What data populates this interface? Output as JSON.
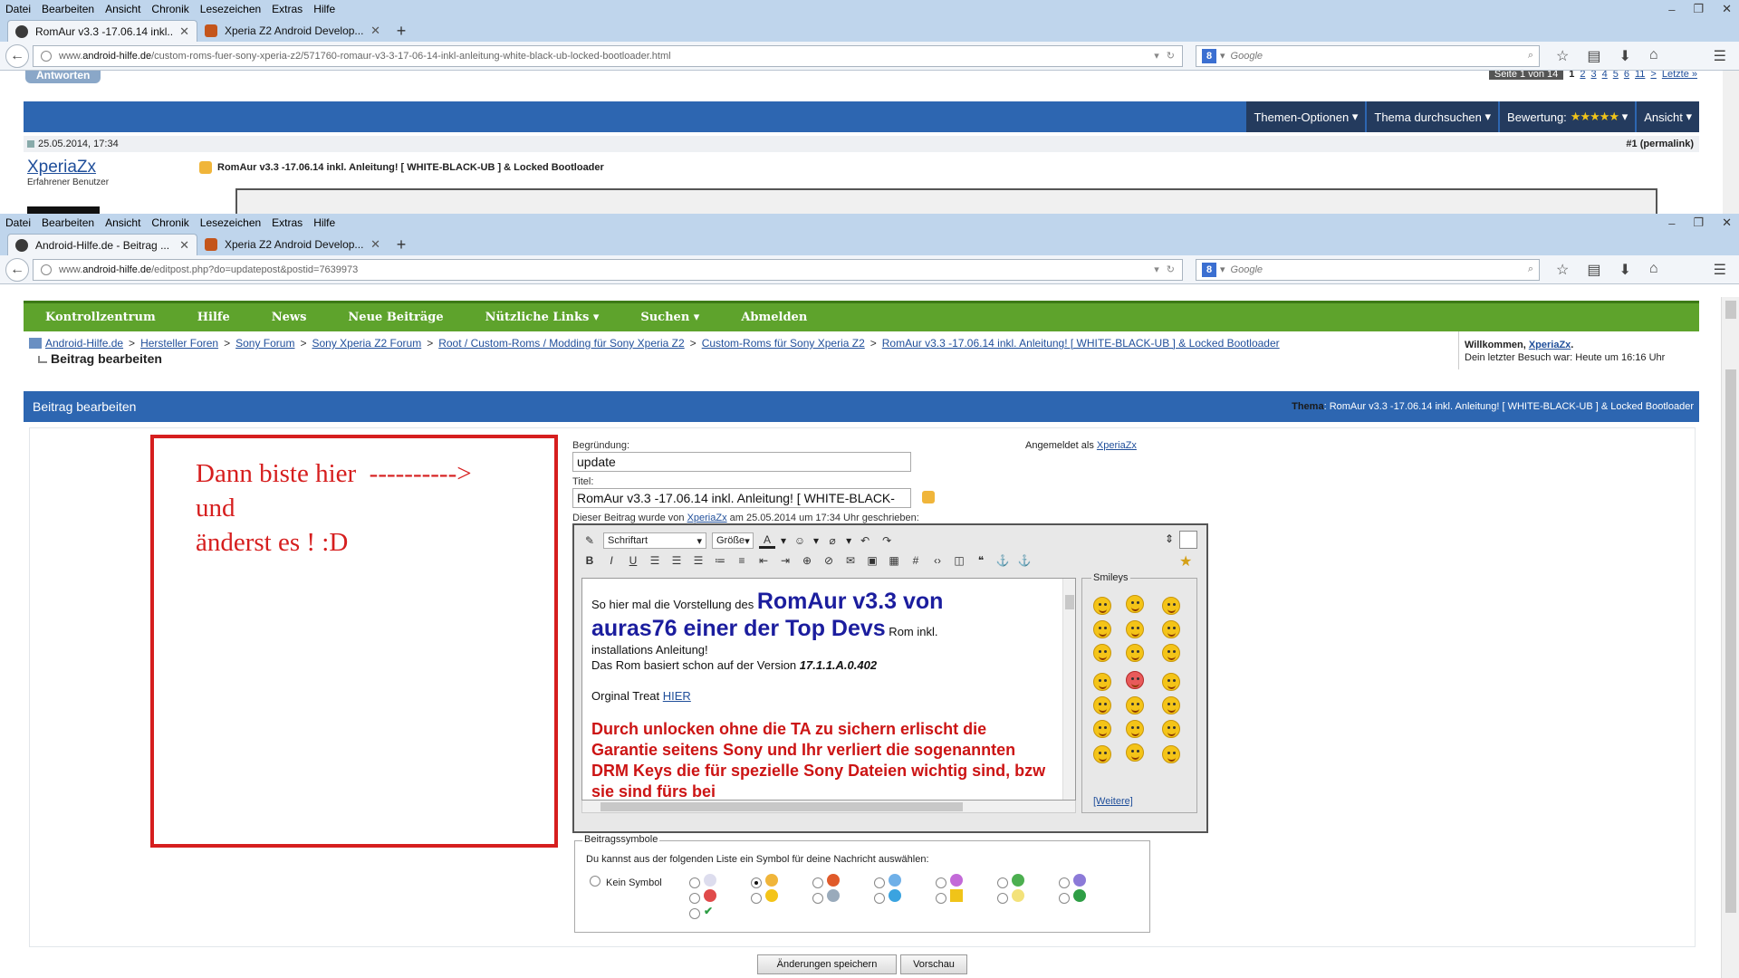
{
  "browser": {
    "menu": [
      "Datei",
      "Bearbeiten",
      "Ansicht",
      "Chronik",
      "Lesezeichen",
      "Extras",
      "Hilfe"
    ],
    "window1": {
      "tabs": [
        {
          "title": "RomAur v3.3 -17.06.14 inkl....",
          "active": true
        },
        {
          "title": "Xperia Z2 Android Develop...",
          "active": false
        }
      ],
      "url_prefix": "www.",
      "url_domain": "android-hilfe.de",
      "url_path": "/custom-roms-fuer-sony-xperia-z2/571760-romaur-v3-3-17-06-14-inkl-anleitung-white-black-ub-locked-bootloader.html"
    },
    "window2": {
      "tabs": [
        {
          "title": "Android-Hilfe.de - Beitrag ...",
          "active": true
        },
        {
          "title": "Xperia Z2 Android Develop...",
          "active": false
        }
      ],
      "url_prefix": "www.",
      "url_domain": "android-hilfe.de",
      "url_path": "/editpost.php?do=updatepost&postid=7639973"
    },
    "search_placeholder": "Google",
    "search_engine_letter": "8"
  },
  "thread_page": {
    "reply_button": "Antworten",
    "pager": {
      "label": "Seite 1 von 14",
      "pages": [
        "1",
        "2",
        "3",
        "4",
        "5",
        "6",
        "11",
        ">",
        "Letzte »"
      ]
    },
    "options": [
      "Themen-Optionen",
      "Thema durchsuchen",
      "Bewertung:",
      "Ansicht"
    ],
    "rating_stars": "★★★★★",
    "post_date": "25.05.2014, 17:34",
    "permalink": "#1 (permalink)",
    "author": "XperiaZx",
    "author_title": "Erfahrener Benutzer",
    "post_title": "RomAur v3.3 -17.06.14 inkl. Anleitung! [ WHITE-BLACK-UB ] & Locked Bootloader"
  },
  "edit_page": {
    "nav": [
      "Kontrollzentrum",
      "Hilfe",
      "News",
      "Neue Beiträge",
      "Nützliche Links ▾",
      "Suchen ▾",
      "Abmelden"
    ],
    "breadcrumb": [
      "Android-Hilfe.de",
      "Hersteller Foren",
      "Sony Forum",
      "Sony Xperia Z2 Forum",
      "Root / Custom-Roms / Modding für Sony Xperia Z2",
      "Custom-Roms für Sony Xperia Z2",
      "RomAur v3.3 -17.06.14 inkl. Anleitung! [ WHITE-BLACK-UB ] & Locked Bootloader"
    ],
    "breadcrumb_sep": ">",
    "current": "Beitrag bearbeiten",
    "welcome_prefix": "Willkommen, ",
    "welcome_user": "XperiaZx",
    "welcome_dot": ".",
    "last_visit": "Dein letzter Besuch war: Heute um 16:16 Uhr",
    "header": "Beitrag bearbeiten",
    "thema_label": "Thema",
    "thema_value": ": RomAur v3.3 -17.06.14 inkl. Anleitung! [ WHITE-BLACK-UB ] & Locked Bootloader",
    "annotation": "Dann biste hier  ---------->\nund\nänderst es ! :D",
    "begruendung_label": "Begründung:",
    "begruendung_value": "update",
    "titel_label": "Titel:",
    "titel_value": "RomAur v3.3 -17.06.14 inkl. Anleitung! [ WHITE-BLACK-",
    "angemeldet_prefix": "Angemeldet als ",
    "angemeldet_user": "XperiaZx",
    "written_prefix": "Dieser Beitrag wurde von ",
    "written_user": "XperiaZx",
    "written_suffix": " am 25.05.2014 um 17:34 Uhr geschrieben:",
    "editor": {
      "font_label": "Schriftart",
      "size_label": "Größe",
      "content": {
        "line1_pre": "So hier mal die Vorstellung des ",
        "big1": "RomAur v3.3 von",
        "big2": "auras76 einer der Top Devs",
        "line2_post": " Rom inkl.",
        "line3": "installations Anleitung!",
        "line4_pre": "Das Rom basiert schon auf der Version ",
        "version": "17.1.1.A.0.402",
        "treat_pre": "Orginal Treat ",
        "treat_link": "HIER",
        "warning": "Durch unlocken ohne die TA zu sichern erlischt die Garantie seitens Sony und Ihr verliert die sogenannten DRM Keys die für spezielle Sony Dateien wichtig sind, bzw sie sind fürs bei"
      }
    },
    "smileys_label": "Smileys",
    "smileys_more": "[Weitere]",
    "symbols_label": "Beitragssymbole",
    "symbols_desc": "Du kannst aus der folgenden Liste ein Symbol für deine Nachricht auswählen:",
    "no_symbol": "Kein Symbol",
    "save_button": "Änderungen speichern",
    "preview_button": "Vorschau"
  },
  "colors": {
    "forum_blue": "#2d66b1",
    "forum_green": "#5ea32c",
    "annotation_red": "#d61e1e",
    "editor_title_blue": "#1b1d9e",
    "warning_red": "#cc1414"
  }
}
